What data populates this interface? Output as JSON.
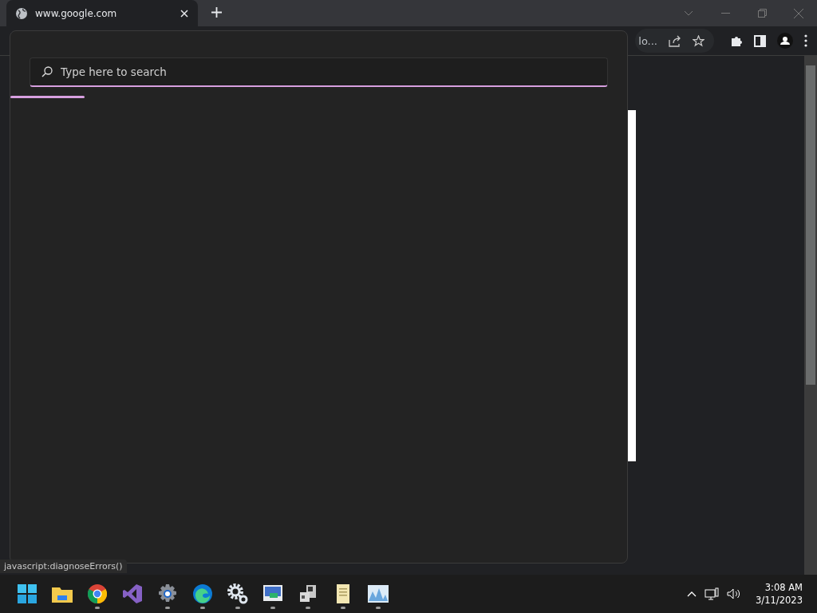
{
  "browser": {
    "tabs": [
      {
        "title": "www.google.com",
        "selected": true
      }
    ],
    "omnibox_tail": "lo..."
  },
  "search_panel": {
    "search": {
      "placeholder": "Type here to search"
    },
    "progress": {
      "level": 0.12
    }
  },
  "status_link": "javascript:diagnoseErrors()",
  "taskbar": {
    "apps": [
      {
        "kind": "start",
        "running": false
      },
      {
        "kind": "folder",
        "running": false
      },
      {
        "kind": "chrome",
        "running": true
      },
      {
        "kind": "studio",
        "running": false
      },
      {
        "kind": "gear",
        "running": true
      },
      {
        "kind": "edge",
        "running": true
      },
      {
        "kind": "gears",
        "running": true
      },
      {
        "kind": "monitor",
        "running": true
      },
      {
        "kind": "server",
        "running": true
      },
      {
        "kind": "scroll",
        "running": true
      },
      {
        "kind": "chart",
        "running": true
      }
    ],
    "clock": {
      "time": "3:08 AM",
      "date": "3/11/2023"
    }
  }
}
